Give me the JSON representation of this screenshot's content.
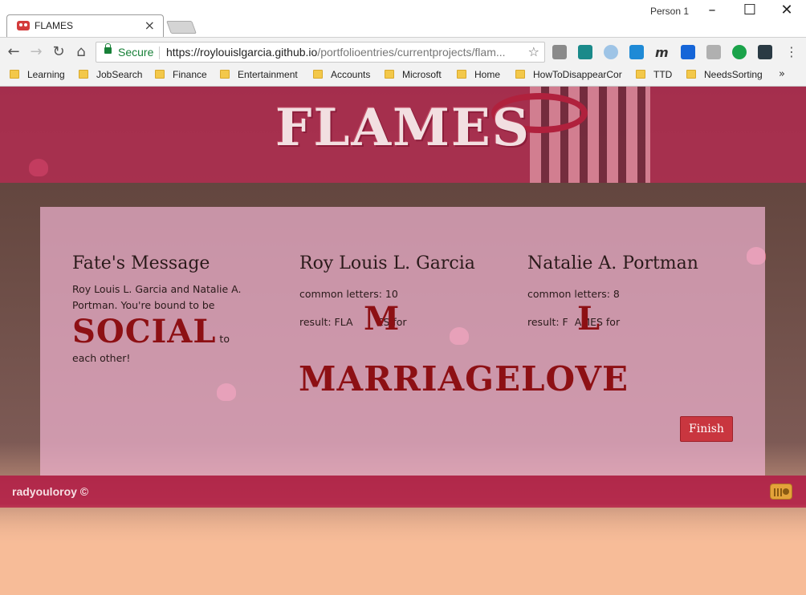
{
  "browser": {
    "tab_title": "FLAMES",
    "profile": "Person 1",
    "secure_label": "Secure",
    "url_host": "https://roylouislgarcia.github.io",
    "url_path": "/portfolioentries/currentprojects/flam...",
    "bookmarks": [
      "Learning",
      "JobSearch",
      "Finance",
      "Entertainment",
      "Accounts",
      "Microsoft",
      "Home",
      "HowToDisappearCor",
      "TTD",
      "NeedsSorting"
    ],
    "bookmarks_more": "»"
  },
  "page": {
    "title": "FLAMES",
    "fate_heading": "Fate's Message",
    "fate_message_pre": "Roy Louis L. Garcia and Natalie A. Portman. You're bound to be",
    "fate_word": "SOCIAL",
    "fate_message_post": "to",
    "fate_message_end": "each other!",
    "person1": {
      "name": "Roy Louis L. Garcia",
      "common_letters": "common letters: 10",
      "result_prefix": "result: FLA",
      "result_letter": "M",
      "result_suffix": "ES for"
    },
    "person2": {
      "name": "Natalie A. Portman",
      "common_letters": "common letters: 8",
      "result_prefix": "result: F",
      "result_letter": "L",
      "result_suffix": "AMES for"
    },
    "final_result": "MARRIAGELOVE",
    "finish_button": "Finish",
    "footer_text": "radyouloroy ©",
    "colors": {
      "accent_red": "#8d1014",
      "header_band": "#be2a54",
      "panel_pink": "#eeb2ce",
      "footer": "#b21c46",
      "button": "#c9363f"
    }
  }
}
